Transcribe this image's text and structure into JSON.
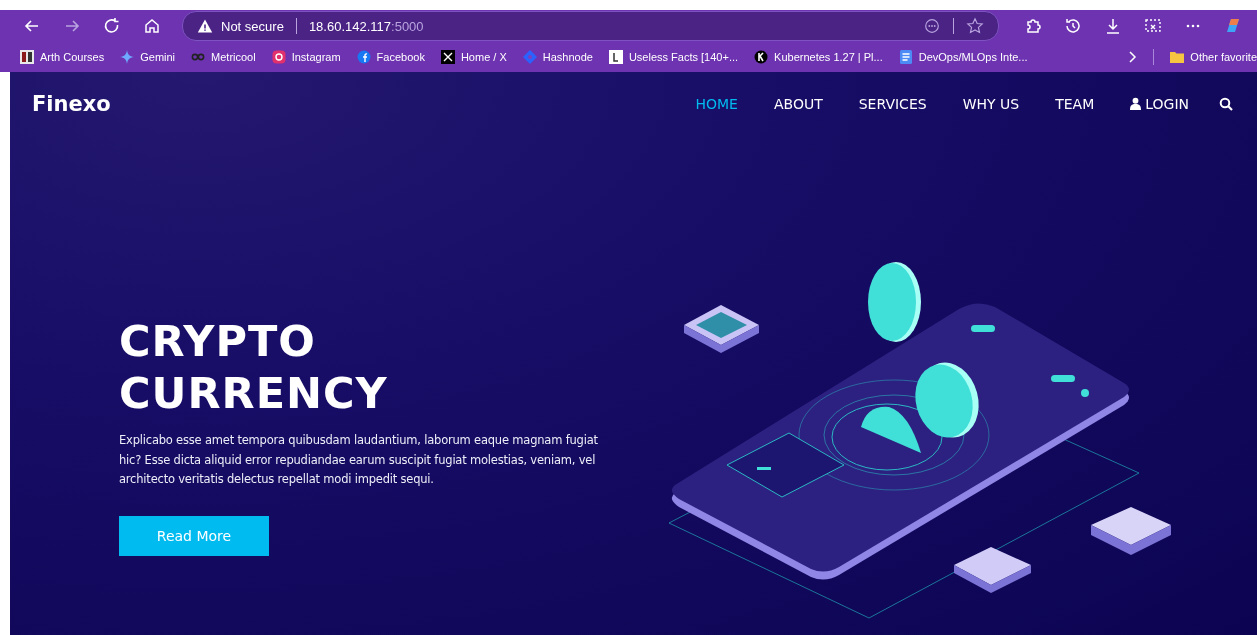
{
  "browser": {
    "security": "Not secure",
    "host": "18.60.142.117",
    "port": ":5000",
    "bookmarks": [
      {
        "label": "Arth Courses",
        "kind": "grid"
      },
      {
        "label": "Gemini",
        "kind": "sparkle"
      },
      {
        "label": "Metricool",
        "kind": "loop"
      },
      {
        "label": "Instagram",
        "kind": "camera"
      },
      {
        "label": "Facebook",
        "kind": "round"
      },
      {
        "label": "Home / X",
        "kind": "cross"
      },
      {
        "label": "Hashnode",
        "kind": "diamond"
      },
      {
        "label": "Useless Facts [140+...",
        "kind": "page"
      },
      {
        "label": "Kubernetes 1.27 | Pl...",
        "kind": "disc"
      },
      {
        "label": "DevOps/MLOps Inte...",
        "kind": "doc"
      }
    ],
    "other": "Other favorite"
  },
  "site": {
    "brand": "Finexo",
    "nav": [
      {
        "label": "HOME",
        "selected": true,
        "kind": "link"
      },
      {
        "label": "ABOUT",
        "selected": false,
        "kind": "link"
      },
      {
        "label": "SERVICES",
        "selected": false,
        "kind": "link"
      },
      {
        "label": "WHY US",
        "selected": false,
        "kind": "link"
      },
      {
        "label": "TEAM",
        "selected": false,
        "kind": "link"
      },
      {
        "label": "LOGIN",
        "selected": false,
        "kind": "login"
      }
    ],
    "hero": {
      "title": [
        "CRYPTO",
        "CURRENCY"
      ],
      "text": "Explicabo esse amet tempora quibusdam laudantium, laborum eaque magnam fugiat hic? Esse dicta aliquid error repudiandae earum suscipit fugiat molestias, veniam, vel architecto veritatis delectus repellat modi impedit sequi.",
      "button": "Read More"
    }
  }
}
